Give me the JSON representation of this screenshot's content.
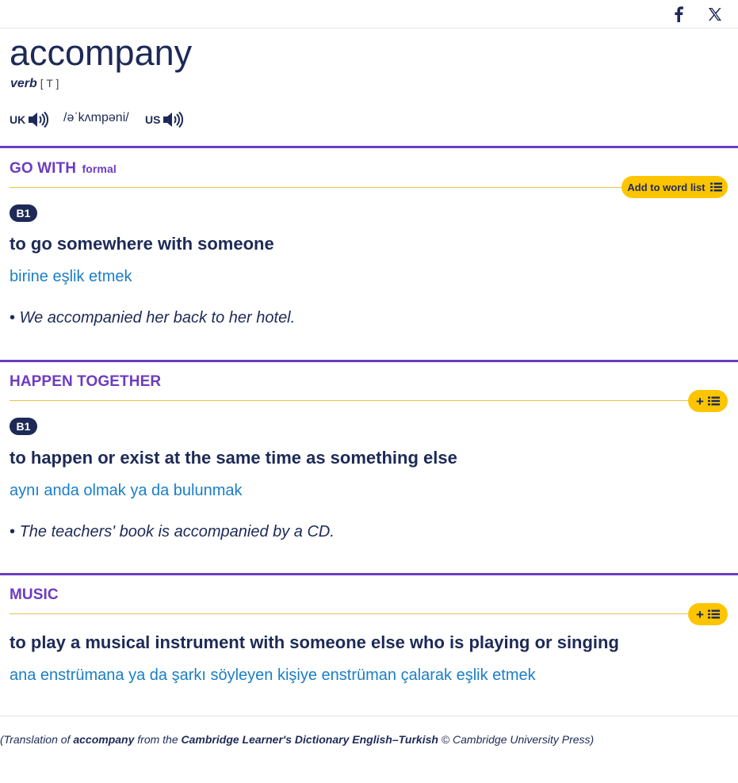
{
  "share": {
    "facebook_icon": "facebook-icon",
    "x_icon": "x-icon"
  },
  "entry": {
    "headword": "accompany",
    "pos": "verb",
    "grammar": "[ T ]",
    "pron": {
      "uk_label": "UK",
      "ipa": "/əˈkʌmpəni/",
      "us_label": "US",
      "audio_icon": "speaker-icon"
    }
  },
  "senses": [
    {
      "guide": "GO WITH",
      "register": "formal",
      "wordlist_label": "Add to word list",
      "level": "B1",
      "definition": "to go somewhere with someone",
      "translation": "birine eşlik etmek",
      "example_bullet": "•",
      "example": "We accompanied her back to her hotel."
    },
    {
      "guide": "HAPPEN TOGETHER",
      "wordlist_label": "+",
      "level": "B1",
      "definition": "to happen or exist at the same time as something else",
      "translation": "aynı anda olmak ya da bulunmak",
      "example_bullet": "•",
      "example": "The teachers' book is accompanied by a CD."
    },
    {
      "guide": "MUSIC",
      "wordlist_label": "+",
      "definition": "to play a musical instrument with someone else who is playing or singing",
      "translation": "ana enstrümana ya da şarkı söyleyen kişiye enstrüman çalarak eşlik etmek"
    }
  ],
  "footer": {
    "p1": "(Translation of ",
    "word": "accompany",
    "p2": " from the ",
    "dict": "Cambridge Learner's Dictionary English–Turkish",
    "p3": " © Cambridge University Press)"
  },
  "colors": {
    "navy": "#1d2a57",
    "purple": "#6c3cc1",
    "link_blue": "#1b7ec7",
    "yellow": "#fdc500"
  }
}
